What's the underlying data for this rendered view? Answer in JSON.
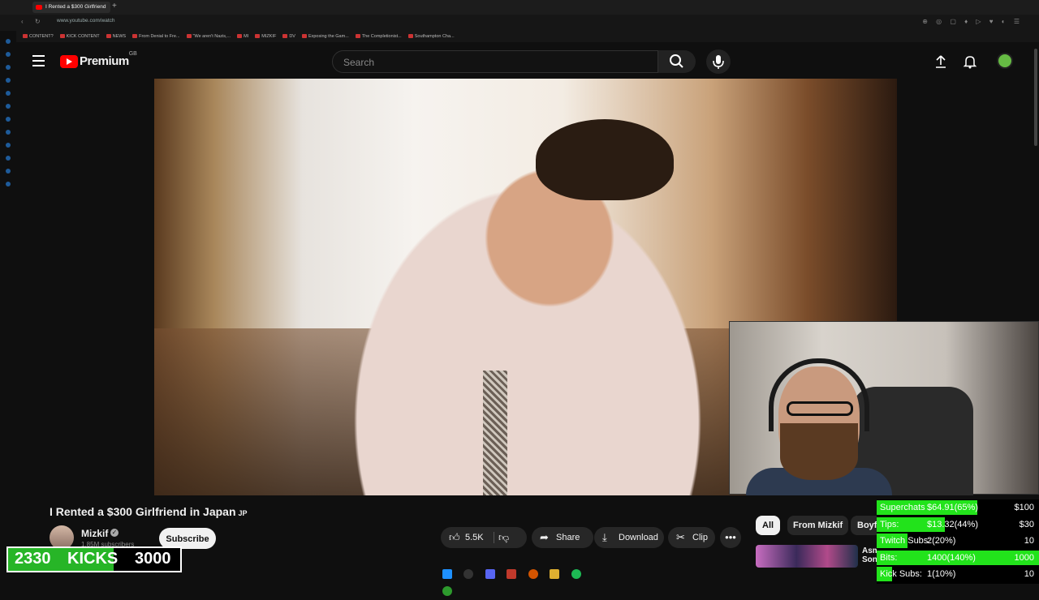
{
  "browser": {
    "tab_title": "I Rented a $300 Girlfriend",
    "url": "www.youtube.com/watch",
    "bookmarks": [
      "CONTENT?",
      "KICK CONTENT",
      "NEWS",
      "From Denial to Fre...",
      "\"We aren't Nazis,...",
      "MI",
      "MIZKIF",
      "DV",
      "Exposing the Gam...",
      "The Completionist...",
      "Southampton Cha..."
    ]
  },
  "header": {
    "logo_text": "Premium",
    "region": "GB",
    "search_placeholder": "Search"
  },
  "video": {
    "title": "I Rented a $300 Girlfriend in Japan",
    "title_flag": "JP",
    "channel": "Mizkif",
    "subscribers": "1.85M subscribers",
    "subscribe_label": "Subscribe",
    "likes": "5.5K",
    "share_label": "Share",
    "download_label": "Download",
    "clip_label": "Clip"
  },
  "recommendations": {
    "chips": [
      "All",
      "From Mizkif",
      "Boyfr"
    ],
    "first_title": "Asm\nSon"
  },
  "kicks_goal": {
    "current": "2330",
    "label": "KICKS",
    "goal": "3000",
    "progress": 0.777
  },
  "stream_goals": [
    {
      "label": "Superchats",
      "value": "$64.91(65%)",
      "goal": "$100",
      "progress": 0.65
    },
    {
      "label": "Tips:",
      "value": "$13.32(44%)",
      "goal": "$30",
      "progress": 0.44
    },
    {
      "label": "Twitch Subs:",
      "value": "2(20%)",
      "goal": "10",
      "progress": 0.2
    },
    {
      "label": "Bits:",
      "value": "1400(140%)",
      "goal": "1000",
      "progress": 1.0
    },
    {
      "label": "Kick Subs:",
      "value": "1(10%)",
      "goal": "10",
      "progress": 0.1
    }
  ],
  "colors": {
    "brand": "#ff0000",
    "goal_fill": "#22e31b",
    "kicks_fill": "#27b527"
  }
}
